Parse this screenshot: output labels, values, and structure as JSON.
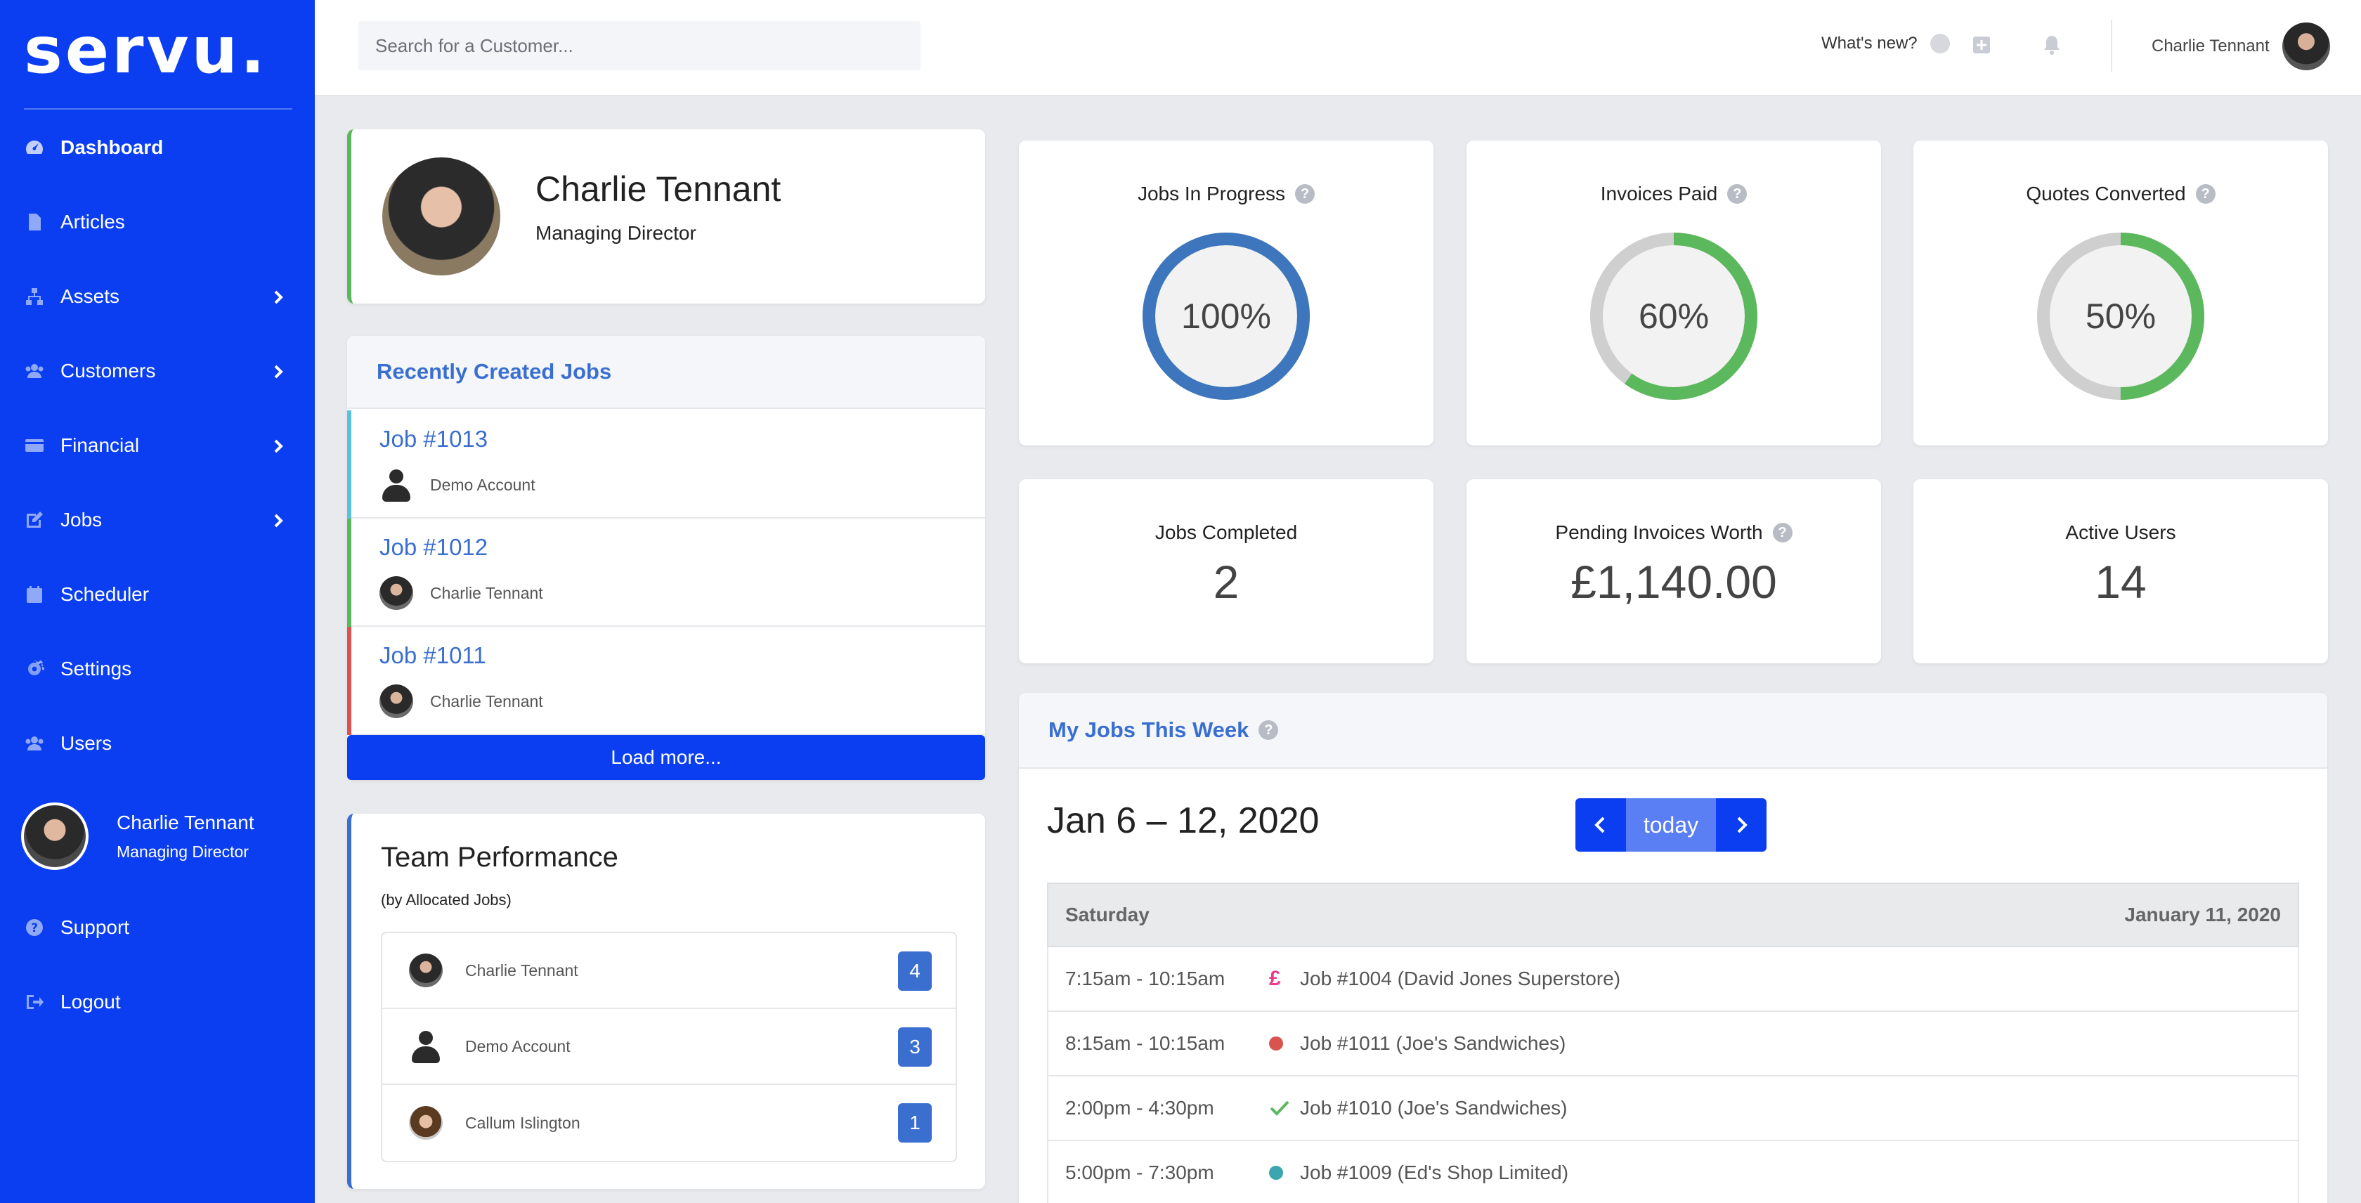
{
  "brand": {
    "logo": "servu."
  },
  "sidebar": {
    "items": [
      {
        "label": "Dashboard",
        "icon": "dashboard-icon"
      },
      {
        "label": "Articles",
        "icon": "document-icon"
      },
      {
        "label": "Assets",
        "icon": "sitemap-icon"
      },
      {
        "label": "Customers",
        "icon": "users-icon"
      },
      {
        "label": "Financial",
        "icon": "credit-card-icon"
      },
      {
        "label": "Jobs",
        "icon": "edit-icon"
      },
      {
        "label": "Scheduler",
        "icon": "calendar-icon"
      },
      {
        "label": "Settings",
        "icon": "gear-icon"
      },
      {
        "label": "Users",
        "icon": "users-icon"
      }
    ],
    "user": {
      "name": "Charlie Tennant",
      "role": "Managing Director"
    },
    "support_label": "Support",
    "logout_label": "Logout"
  },
  "topbar": {
    "search_placeholder": "Search for a Customer...",
    "whats_new": "What's new?",
    "user_name": "Charlie Tennant"
  },
  "profile": {
    "name": "Charlie Tennant",
    "role": "Managing Director"
  },
  "recent_jobs": {
    "title": "Recently Created Jobs",
    "items": [
      {
        "job": "Job #1013",
        "user": "Demo Account",
        "color": "#5bc0de"
      },
      {
        "job": "Job #1012",
        "user": "Charlie Tennant",
        "color": "#5cb85c"
      },
      {
        "job": "Job #1011",
        "user": "Charlie Tennant",
        "color": "#d9534f"
      }
    ],
    "load_more": "Load more..."
  },
  "team": {
    "title": "Team Performance",
    "subtitle": "(by Allocated Jobs)",
    "members": [
      {
        "name": "Charlie Tennant",
        "count": "4"
      },
      {
        "name": "Demo Account",
        "count": "3"
      },
      {
        "name": "Callum Islington",
        "count": "1"
      }
    ]
  },
  "stats": {
    "jobs_in_progress": {
      "title": "Jobs In Progress",
      "value": "100%",
      "fraction": 1.0,
      "color": "#3d76bd"
    },
    "invoices_paid": {
      "title": "Invoices Paid",
      "value": "60%",
      "fraction": 0.6,
      "color": "#5cb85c"
    },
    "quotes_converted": {
      "title": "Quotes Converted",
      "value": "50%",
      "fraction": 0.5,
      "color": "#5cb85c"
    },
    "jobs_completed": {
      "title": "Jobs Completed",
      "value": "2"
    },
    "pending_invoices": {
      "title": "Pending Invoices Worth",
      "value": "£1,140.00"
    },
    "active_users": {
      "title": "Active Users",
      "value": "14"
    }
  },
  "week": {
    "title": "My Jobs This Week",
    "range": "Jan 6 – 12, 2020",
    "today_label": "today",
    "day_name": "Saturday",
    "day_date": "January 11, 2020",
    "events": [
      {
        "time": "7:15am - 10:15am",
        "icon": "pound-icon",
        "symbol": "£",
        "color": "#e83e8c",
        "label": "Job #1004 (David Jones Superstore)"
      },
      {
        "time": "8:15am - 10:15am",
        "icon": "red-dot-icon",
        "color": "#d9534f",
        "label": "Job #1011 (Joe's Sandwiches)"
      },
      {
        "time": "2:00pm - 4:30pm",
        "icon": "check-icon",
        "color": "#5cb85c",
        "label": "Job #1010 (Joe's Sandwiches)"
      },
      {
        "time": "5:00pm - 7:30pm",
        "icon": "teal-dot-icon",
        "color": "#3aa6b0",
        "label": "Job #1009 (Ed's Shop Limited)"
      }
    ]
  }
}
